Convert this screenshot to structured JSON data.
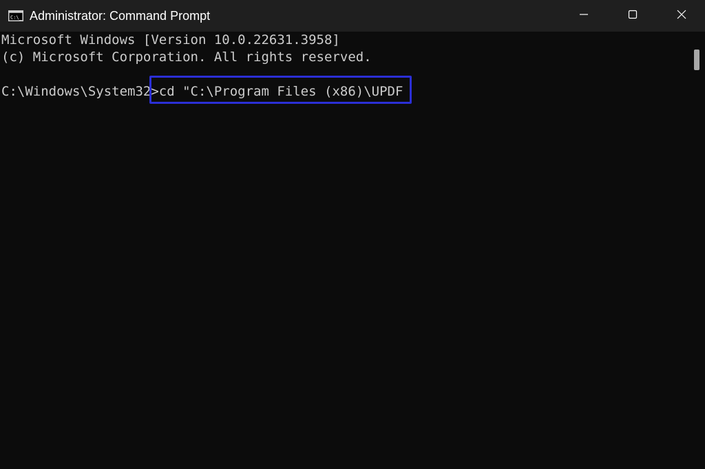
{
  "window": {
    "title": "Administrator: Command Prompt",
    "icon": "cmd-icon"
  },
  "controls": {
    "minimize_icon": "minimize-icon",
    "maximize_icon": "maximize-icon",
    "close_icon": "close-icon"
  },
  "console": {
    "lines": [
      "Microsoft Windows [Version 10.0.22631.3958]",
      "(c) Microsoft Corporation. All rights reserved.",
      ""
    ],
    "prompt": "C:\\Windows\\System32>",
    "command": "cd \"C:\\Program Files (x86)\\UPDF"
  },
  "colors": {
    "background": "#0c0c0c",
    "titlebar": "#1f1f1f",
    "text": "#cccccc",
    "highlight_border": "#2b2fd6"
  }
}
